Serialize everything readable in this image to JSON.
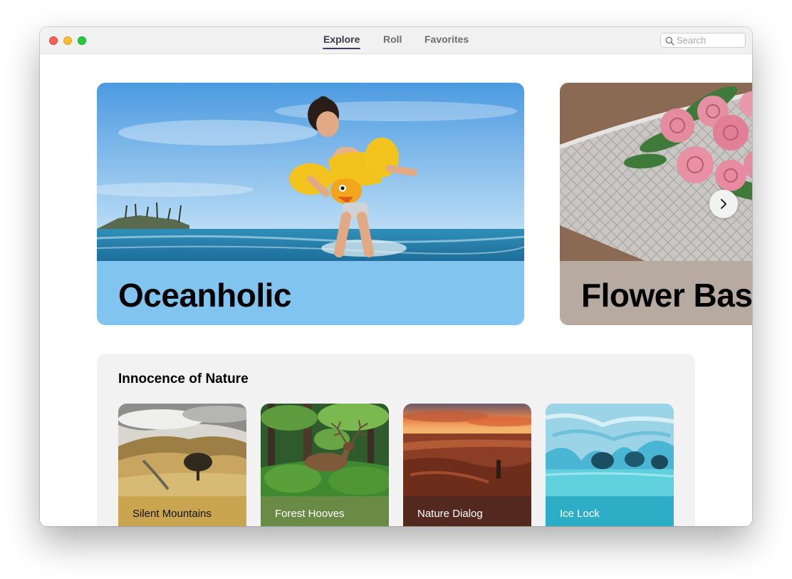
{
  "window": {
    "tabs": {
      "explore": "Explore",
      "roll": "Roll",
      "favorites": "Favorites"
    },
    "active_tab": "Explore",
    "search": {
      "placeholder": "Search",
      "value": ""
    }
  },
  "featured": [
    {
      "title": "Oceanholic",
      "band_color": "#82c4f0"
    },
    {
      "title": "Flower Basket",
      "band_color": "#b7aaa0"
    }
  ],
  "collection": {
    "title": "Innocence of Nature",
    "cards": [
      {
        "label": "Silent Mountains",
        "color": "#c9a54f",
        "text_color": "#111111"
      },
      {
        "label": "Forest Hooves",
        "color": "#6a8b45",
        "text_color": "#ffffff"
      },
      {
        "label": "Nature Dialog",
        "color": "#53281f",
        "text_color": "#ffffff"
      },
      {
        "label": "Ice Lock",
        "color": "#2eaec6",
        "text_color": "#ffffff"
      }
    ]
  },
  "icons": {
    "search": "magnifier-icon",
    "next": "chevron-right-icon"
  }
}
